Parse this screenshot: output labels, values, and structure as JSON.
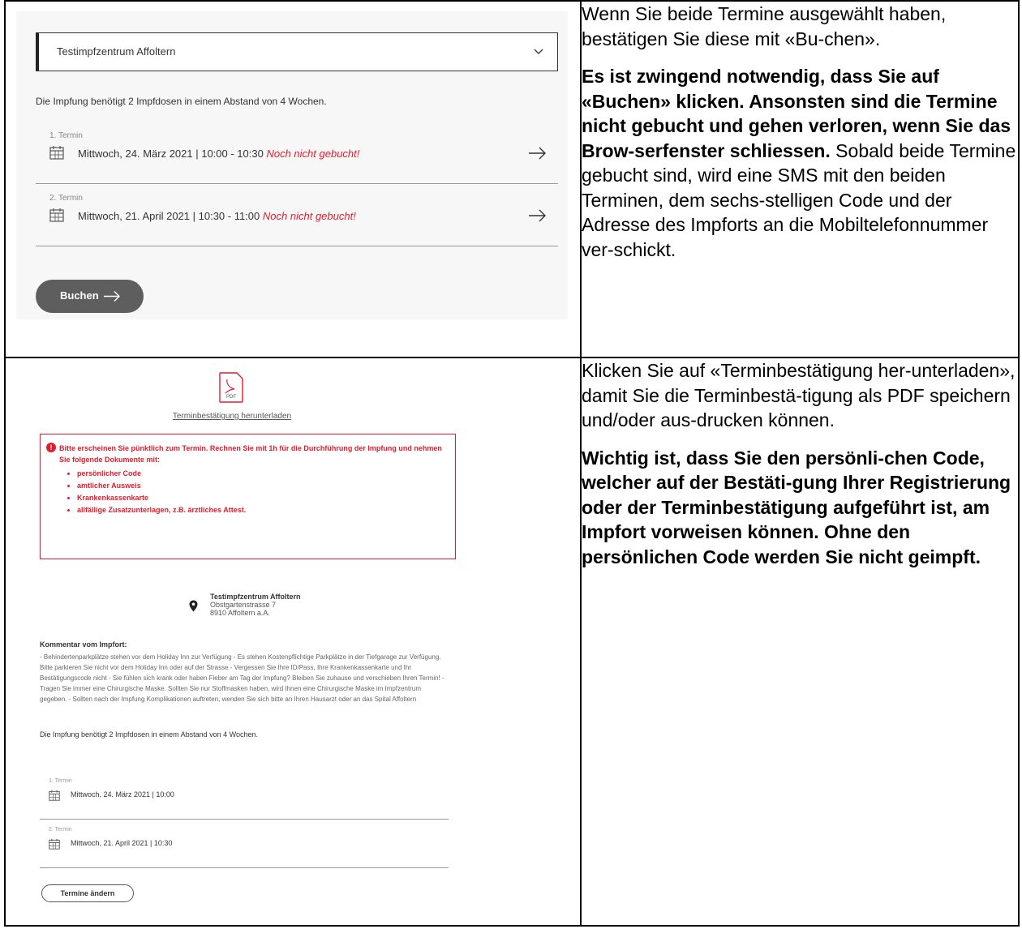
{
  "step1": {
    "screenshot": {
      "center_select": {
        "value": "Testimpfzentrum Affoltern"
      },
      "dose_note": "Die Impfung benötigt 2 Impfdosen in einem Abstand von 4 Wochen.",
      "appointments": [
        {
          "label": "1. Termin",
          "date": "Mittwoch, 24. März 2021 | 10:00 - 10:30",
          "status": "Noch nicht gebucht!"
        },
        {
          "label": "2. Termin",
          "date": "Mittwoch, 21. April 2021 | 10:30 - 11:00",
          "status": "Noch nicht gebucht!"
        }
      ],
      "book_button": "Buchen"
    },
    "instructions": {
      "p1": "Wenn Sie beide Termine ausgewählt haben, bestätigen Sie diese mit «Bu-chen».",
      "p2_bold": "Es ist zwingend notwendig, dass Sie auf «Buchen» klicken. Ansonsten sind die Termine nicht gebucht und gehen verloren, wenn Sie das Brow-serfenster schliessen.",
      "p2_rest": " Sobald beide Termine gebucht sind, wird eine SMS mit den beiden Terminen, dem sechs-stelligen Code und der Adresse des Impforts an die Mobiltelefonnummer ver-schickt."
    }
  },
  "step2": {
    "screenshot": {
      "pdf_icon_text": "PDF",
      "download_link": "Terminbestätigung herunterladen",
      "alert": {
        "text": "Bitte erscheinen Sie pünktlich zum Termin. Rechnen Sie mit 1h für die Durchführung der Impfung und nehmen Sie folgende Dokumente mit:",
        "items": [
          "persönlicher Code",
          "amtlicher Ausweis",
          "Krankenkassenkarte",
          "allfällige Zusatzunterlagen, z.B. ärztliches Attest."
        ]
      },
      "location": {
        "name": "Testimpfzentrum Affoltern",
        "street": "Obstgartenstrasse 7",
        "city": "8910 Affoltern a.A."
      },
      "comment_title": "Kommentar vom Impfort:",
      "comment_text": "- Behindertenparkplätze stehen vor dem Holiday Inn zur Verfügung - Es stehen Kostenpflichtige Parkplätze in der Tiefgarage zur Verfügung. Bitte parkieren Sie nicht vor dem Holiday Inn oder auf der Strasse - Vergessen Sie Ihre ID/Pass, Ihre Krankenkassenkarte und Ihr Bestätigungscode nicht - Sie fühlen sich krank oder haben Fieber am Tag der Impfung? Bleiben Sie zuhause und verschieben Ihren Termin! - Tragen Sie immer eine Chirurgische Maske. Sollten Sie nur Stoffmasken haben, wird Ihnen eine Chirurgische Maske im Impfzentrum gegeben. - Sollten nach der Impfung Komplikationen auftreten, wenden Sie sich bitte an Ihren Hausarzt oder an das Spital Affoltern",
      "dose_note": "Die Impfung benötigt 2 Impfdosen in einem Abstand von 4 Wochen.",
      "appointments": [
        {
          "label": "1. Termin",
          "date": "Mittwoch, 24. März 2021 | 10:00"
        },
        {
          "label": "2. Termin",
          "date": "Mittwoch, 21. April 2021 | 10:30"
        }
      ],
      "change_button": "Termine ändern"
    },
    "instructions": {
      "p1": "Klicken Sie auf «Terminbestätigung her-unterladen», damit Sie die Terminbestä-tigung als PDF speichern und/oder aus-drucken können.",
      "p2_bold": "Wichtig ist, dass Sie den persönli-chen Code, welcher auf der Bestäti-gung Ihrer Registrierung oder der Terminbestätigung aufgeführt ist, am Impfort vorweisen können. Ohne den persönlichen Code werden Sie nicht geimpft."
    }
  },
  "colors": {
    "warning_red": "#e21c2c",
    "button_gray": "#5e5e5e"
  }
}
